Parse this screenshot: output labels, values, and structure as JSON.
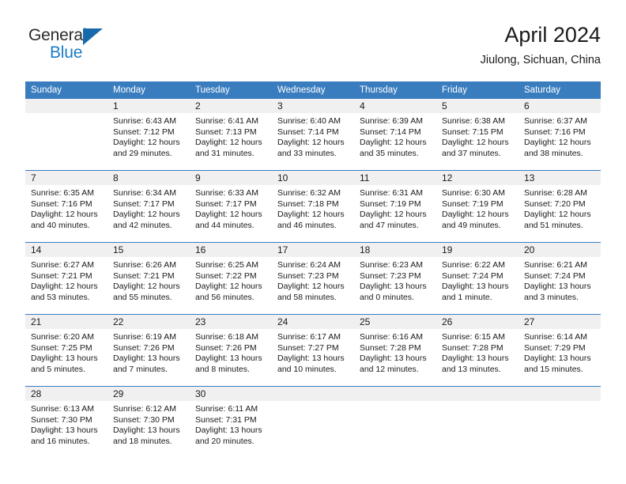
{
  "brand": {
    "name_part1": "General",
    "name_part2": "Blue",
    "accent_color": "#1a7cc4",
    "triangle_color": "#1769ab"
  },
  "header": {
    "title": "April 2024",
    "subtitle": "Jiulong, Sichuan, China"
  },
  "theme": {
    "header_row_bg": "#3a7dbf",
    "day_band_bg": "#f0f0f0",
    "text_color": "#1a1a1a"
  },
  "weekdays": [
    "Sunday",
    "Monday",
    "Tuesday",
    "Wednesday",
    "Thursday",
    "Friday",
    "Saturday"
  ],
  "weeks": [
    [
      {
        "empty": true
      },
      {
        "date": "1",
        "sunrise": "Sunrise: 6:43 AM",
        "sunset": "Sunset: 7:12 PM",
        "daylight1": "Daylight: 12 hours",
        "daylight2": "and 29 minutes."
      },
      {
        "date": "2",
        "sunrise": "Sunrise: 6:41 AM",
        "sunset": "Sunset: 7:13 PM",
        "daylight1": "Daylight: 12 hours",
        "daylight2": "and 31 minutes."
      },
      {
        "date": "3",
        "sunrise": "Sunrise: 6:40 AM",
        "sunset": "Sunset: 7:14 PM",
        "daylight1": "Daylight: 12 hours",
        "daylight2": "and 33 minutes."
      },
      {
        "date": "4",
        "sunrise": "Sunrise: 6:39 AM",
        "sunset": "Sunset: 7:14 PM",
        "daylight1": "Daylight: 12 hours",
        "daylight2": "and 35 minutes."
      },
      {
        "date": "5",
        "sunrise": "Sunrise: 6:38 AM",
        "sunset": "Sunset: 7:15 PM",
        "daylight1": "Daylight: 12 hours",
        "daylight2": "and 37 minutes."
      },
      {
        "date": "6",
        "sunrise": "Sunrise: 6:37 AM",
        "sunset": "Sunset: 7:16 PM",
        "daylight1": "Daylight: 12 hours",
        "daylight2": "and 38 minutes."
      }
    ],
    [
      {
        "date": "7",
        "sunrise": "Sunrise: 6:35 AM",
        "sunset": "Sunset: 7:16 PM",
        "daylight1": "Daylight: 12 hours",
        "daylight2": "and 40 minutes."
      },
      {
        "date": "8",
        "sunrise": "Sunrise: 6:34 AM",
        "sunset": "Sunset: 7:17 PM",
        "daylight1": "Daylight: 12 hours",
        "daylight2": "and 42 minutes."
      },
      {
        "date": "9",
        "sunrise": "Sunrise: 6:33 AM",
        "sunset": "Sunset: 7:17 PM",
        "daylight1": "Daylight: 12 hours",
        "daylight2": "and 44 minutes."
      },
      {
        "date": "10",
        "sunrise": "Sunrise: 6:32 AM",
        "sunset": "Sunset: 7:18 PM",
        "daylight1": "Daylight: 12 hours",
        "daylight2": "and 46 minutes."
      },
      {
        "date": "11",
        "sunrise": "Sunrise: 6:31 AM",
        "sunset": "Sunset: 7:19 PM",
        "daylight1": "Daylight: 12 hours",
        "daylight2": "and 47 minutes."
      },
      {
        "date": "12",
        "sunrise": "Sunrise: 6:30 AM",
        "sunset": "Sunset: 7:19 PM",
        "daylight1": "Daylight: 12 hours",
        "daylight2": "and 49 minutes."
      },
      {
        "date": "13",
        "sunrise": "Sunrise: 6:28 AM",
        "sunset": "Sunset: 7:20 PM",
        "daylight1": "Daylight: 12 hours",
        "daylight2": "and 51 minutes."
      }
    ],
    [
      {
        "date": "14",
        "sunrise": "Sunrise: 6:27 AM",
        "sunset": "Sunset: 7:21 PM",
        "daylight1": "Daylight: 12 hours",
        "daylight2": "and 53 minutes."
      },
      {
        "date": "15",
        "sunrise": "Sunrise: 6:26 AM",
        "sunset": "Sunset: 7:21 PM",
        "daylight1": "Daylight: 12 hours",
        "daylight2": "and 55 minutes."
      },
      {
        "date": "16",
        "sunrise": "Sunrise: 6:25 AM",
        "sunset": "Sunset: 7:22 PM",
        "daylight1": "Daylight: 12 hours",
        "daylight2": "and 56 minutes."
      },
      {
        "date": "17",
        "sunrise": "Sunrise: 6:24 AM",
        "sunset": "Sunset: 7:23 PM",
        "daylight1": "Daylight: 12 hours",
        "daylight2": "and 58 minutes."
      },
      {
        "date": "18",
        "sunrise": "Sunrise: 6:23 AM",
        "sunset": "Sunset: 7:23 PM",
        "daylight1": "Daylight: 13 hours",
        "daylight2": "and 0 minutes."
      },
      {
        "date": "19",
        "sunrise": "Sunrise: 6:22 AM",
        "sunset": "Sunset: 7:24 PM",
        "daylight1": "Daylight: 13 hours",
        "daylight2": "and 1 minute."
      },
      {
        "date": "20",
        "sunrise": "Sunrise: 6:21 AM",
        "sunset": "Sunset: 7:24 PM",
        "daylight1": "Daylight: 13 hours",
        "daylight2": "and 3 minutes."
      }
    ],
    [
      {
        "date": "21",
        "sunrise": "Sunrise: 6:20 AM",
        "sunset": "Sunset: 7:25 PM",
        "daylight1": "Daylight: 13 hours",
        "daylight2": "and 5 minutes."
      },
      {
        "date": "22",
        "sunrise": "Sunrise: 6:19 AM",
        "sunset": "Sunset: 7:26 PM",
        "daylight1": "Daylight: 13 hours",
        "daylight2": "and 7 minutes."
      },
      {
        "date": "23",
        "sunrise": "Sunrise: 6:18 AM",
        "sunset": "Sunset: 7:26 PM",
        "daylight1": "Daylight: 13 hours",
        "daylight2": "and 8 minutes."
      },
      {
        "date": "24",
        "sunrise": "Sunrise: 6:17 AM",
        "sunset": "Sunset: 7:27 PM",
        "daylight1": "Daylight: 13 hours",
        "daylight2": "and 10 minutes."
      },
      {
        "date": "25",
        "sunrise": "Sunrise: 6:16 AM",
        "sunset": "Sunset: 7:28 PM",
        "daylight1": "Daylight: 13 hours",
        "daylight2": "and 12 minutes."
      },
      {
        "date": "26",
        "sunrise": "Sunrise: 6:15 AM",
        "sunset": "Sunset: 7:28 PM",
        "daylight1": "Daylight: 13 hours",
        "daylight2": "and 13 minutes."
      },
      {
        "date": "27",
        "sunrise": "Sunrise: 6:14 AM",
        "sunset": "Sunset: 7:29 PM",
        "daylight1": "Daylight: 13 hours",
        "daylight2": "and 15 minutes."
      }
    ],
    [
      {
        "date": "28",
        "sunrise": "Sunrise: 6:13 AM",
        "sunset": "Sunset: 7:30 PM",
        "daylight1": "Daylight: 13 hours",
        "daylight2": "and 16 minutes."
      },
      {
        "date": "29",
        "sunrise": "Sunrise: 6:12 AM",
        "sunset": "Sunset: 7:30 PM",
        "daylight1": "Daylight: 13 hours",
        "daylight2": "and 18 minutes."
      },
      {
        "date": "30",
        "sunrise": "Sunrise: 6:11 AM",
        "sunset": "Sunset: 7:31 PM",
        "daylight1": "Daylight: 13 hours",
        "daylight2": "and 20 minutes."
      },
      {
        "empty": true
      },
      {
        "empty": true
      },
      {
        "empty": true
      },
      {
        "empty": true
      }
    ]
  ]
}
